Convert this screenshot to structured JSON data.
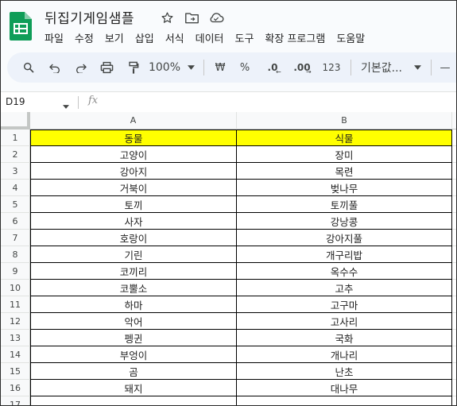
{
  "document": {
    "title": "뒤집기게임샘플",
    "icons": [
      "star-icon",
      "move-to-folder-icon",
      "cloud-saved-icon"
    ]
  },
  "menu": [
    "파일",
    "수정",
    "보기",
    "삽입",
    "서식",
    "데이터",
    "도구",
    "확장 프로그램",
    "도움말"
  ],
  "toolbar": {
    "zoom": "100%",
    "currency": "₩",
    "percent": "%",
    "decimal_decrease": ".0",
    "decimal_increase": ".00",
    "number_format": "123",
    "font": "기본값...",
    "minus": "—"
  },
  "formula_bar": {
    "cell_ref": "D19",
    "fx": "fx",
    "value": ""
  },
  "sheet": {
    "columns": [
      "A",
      "B"
    ],
    "rows": [
      {
        "num": "1",
        "a": "동물",
        "b": "식물",
        "header": true
      },
      {
        "num": "2",
        "a": "고양이",
        "b": "장미"
      },
      {
        "num": "3",
        "a": "강아지",
        "b": "목련"
      },
      {
        "num": "4",
        "a": "거북이",
        "b": "벚나무"
      },
      {
        "num": "5",
        "a": "토끼",
        "b": "토끼풀"
      },
      {
        "num": "6",
        "a": "사자",
        "b": "강낭콩"
      },
      {
        "num": "7",
        "a": "호랑이",
        "b": "강아지풀"
      },
      {
        "num": "8",
        "a": "기린",
        "b": "개구리밥"
      },
      {
        "num": "9",
        "a": "코끼리",
        "b": "옥수수"
      },
      {
        "num": "10",
        "a": "코뿔소",
        "b": "고추"
      },
      {
        "num": "11",
        "a": "하마",
        "b": "고구마"
      },
      {
        "num": "12",
        "a": "악어",
        "b": "고사리"
      },
      {
        "num": "13",
        "a": "펭귄",
        "b": "국화"
      },
      {
        "num": "14",
        "a": "부엉이",
        "b": "개나리"
      },
      {
        "num": "15",
        "a": "곰",
        "b": "난초"
      },
      {
        "num": "16",
        "a": "돼지",
        "b": "대나무"
      },
      {
        "num": "17",
        "a": "",
        "b": ""
      }
    ],
    "header_fill": "#ffff00"
  },
  "colors": {
    "brand": "#0f9d58",
    "toolbar_bg": "#edf2fa"
  }
}
